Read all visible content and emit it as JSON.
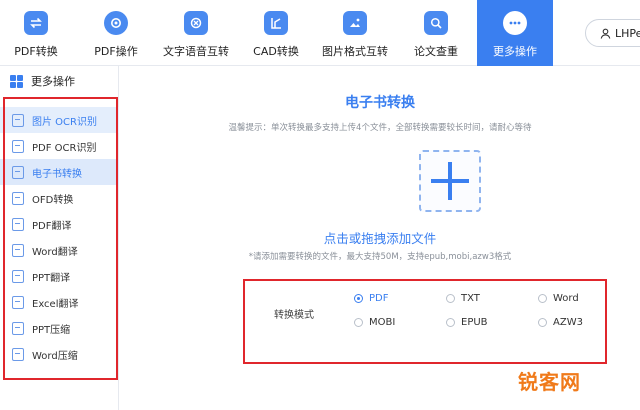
{
  "toolbar": {
    "items": [
      {
        "label": "PDF转换",
        "icon": "pdf-convert-icon"
      },
      {
        "label": "PDF操作",
        "icon": "gear-icon"
      },
      {
        "label": "文字语音互转",
        "icon": "text-speech-icon"
      },
      {
        "label": "CAD转换",
        "icon": "cad-icon"
      },
      {
        "label": "图片格式互转",
        "icon": "image-icon"
      },
      {
        "label": "论文查重",
        "icon": "search-doc-icon"
      },
      {
        "label": "更多操作",
        "icon": "more-icon",
        "active": true
      }
    ],
    "user_label": "LHPe"
  },
  "sidebar": {
    "header": "更多操作",
    "items": [
      {
        "label": "图片 OCR识别"
      },
      {
        "label": "PDF OCR识别"
      },
      {
        "label": "电子书转换",
        "selected": true
      },
      {
        "label": "OFD转换"
      },
      {
        "label": "PDF翻译"
      },
      {
        "label": "Word翻译"
      },
      {
        "label": "PPT翻译"
      },
      {
        "label": "Excel翻译"
      },
      {
        "label": "PPT压缩"
      },
      {
        "label": "Word压缩"
      }
    ]
  },
  "main": {
    "title": "电子书转换",
    "tip": "温馨提示：单次转换最多支持上传4个文件，全部转换需要较长时间，请耐心等待",
    "upload_text": "点击或拖拽添加文件",
    "support_text": "*请添加需要转换的文件，最大支持50M，支持epub,mobi,azw3格式",
    "mode_label": "转换模式",
    "modes": [
      {
        "label": "PDF",
        "checked": true
      },
      {
        "label": "TXT"
      },
      {
        "label": "Word"
      },
      {
        "label": "MOBI"
      },
      {
        "label": "EPUB"
      },
      {
        "label": "AZW3"
      }
    ]
  },
  "watermark": "锐客网",
  "colors": {
    "accent": "#3a7ff0",
    "highlight_box": "#e0262c",
    "watermark": "#f07a1a"
  }
}
